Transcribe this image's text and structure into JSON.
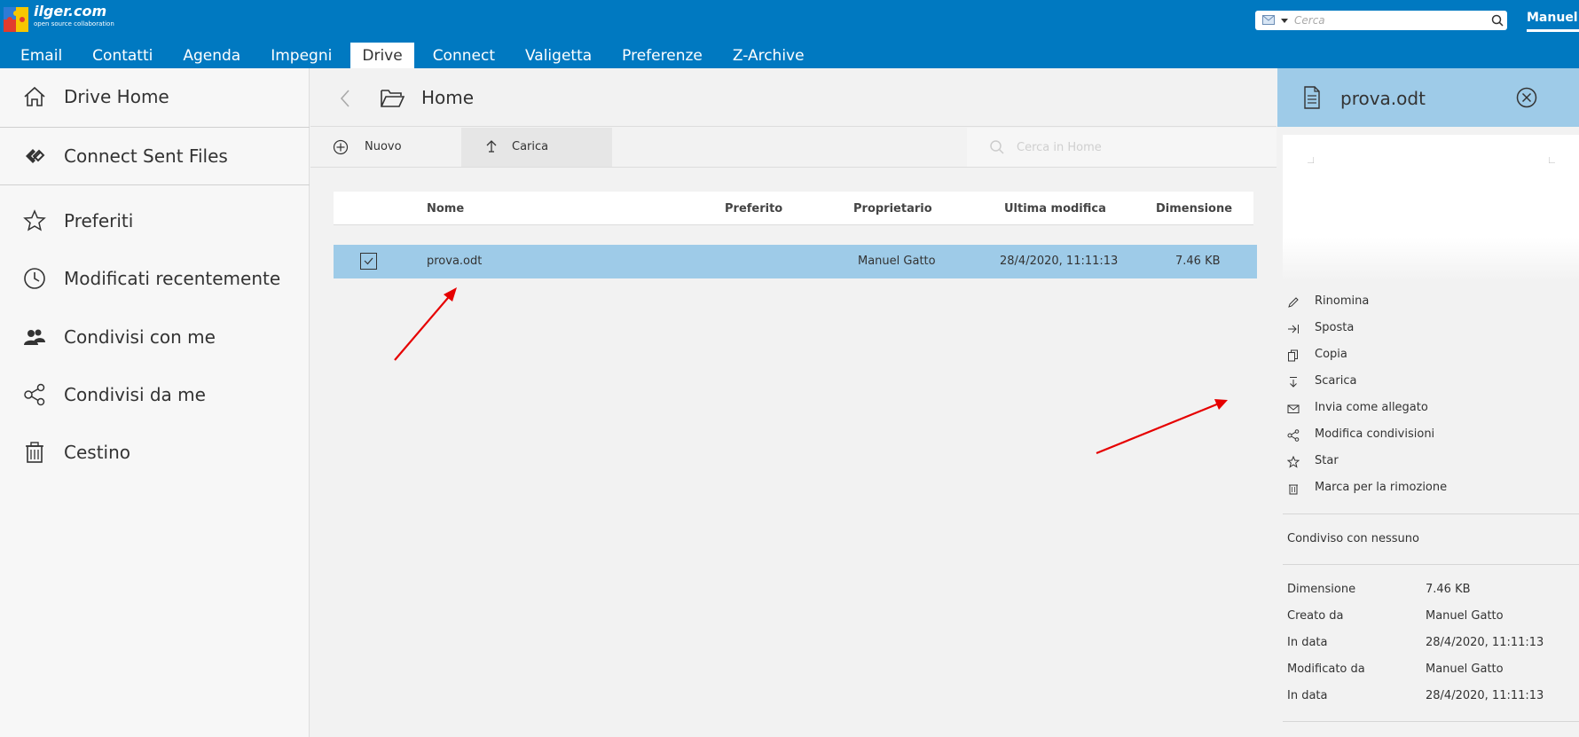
{
  "app": {
    "logo_text": "ilger.com",
    "logo_sub": "open source collaboration",
    "search_placeholder": "Cerca",
    "user": "Manuel"
  },
  "tabs": [
    {
      "label": "Email"
    },
    {
      "label": "Contatti"
    },
    {
      "label": "Agenda"
    },
    {
      "label": "Impegni"
    },
    {
      "label": "Drive",
      "active": true
    },
    {
      "label": "Connect"
    },
    {
      "label": "Valigetta"
    },
    {
      "label": "Preferenze"
    },
    {
      "label": "Z-Archive"
    }
  ],
  "sidebar": {
    "items": [
      {
        "label": "Drive Home",
        "icon": "home-icon"
      },
      {
        "label": "Connect Sent Files",
        "icon": "connect-icon"
      },
      {
        "label": "Preferiti",
        "icon": "star-icon"
      },
      {
        "label": "Modificati recentemente",
        "icon": "clock-icon"
      },
      {
        "label": "Condivisi con me",
        "icon": "people-icon"
      },
      {
        "label": "Condivisi da me",
        "icon": "share-icon"
      },
      {
        "label": "Cestino",
        "icon": "trash-icon"
      }
    ]
  },
  "main": {
    "breadcrumb": "Home",
    "toolbar": {
      "new_label": "Nuovo",
      "upload_label": "Carica",
      "search_placeholder": "Cerca in Home"
    },
    "columns": [
      "Nome",
      "Preferito",
      "Proprietario",
      "Ultima modifica",
      "Dimensione"
    ],
    "rows": [
      {
        "name": "prova.odt",
        "favorite": "",
        "owner": "Manuel Gatto",
        "modified": "28/4/2020, 11:11:13",
        "size": "7.46 KB",
        "selected": true
      }
    ]
  },
  "details": {
    "title": "prova.odt",
    "actions": [
      {
        "label": "Rinomina",
        "icon": "pencil-icon"
      },
      {
        "label": "Sposta",
        "icon": "move-icon"
      },
      {
        "label": "Copia",
        "icon": "copy-icon"
      },
      {
        "label": "Scarica",
        "icon": "download-icon"
      },
      {
        "label": "Invia come allegato",
        "icon": "envelope-icon"
      },
      {
        "label": "Modifica condivisioni",
        "icon": "share-icon"
      },
      {
        "label": "Star",
        "icon": "star-icon"
      },
      {
        "label": "Marca per la rimozione",
        "icon": "trash-icon"
      }
    ],
    "shared_with": "Condiviso con nessuno",
    "properties": [
      {
        "key": "Dimensione",
        "value": "7.46 KB"
      },
      {
        "key": "Creato da",
        "value": "Manuel Gatto"
      },
      {
        "key": "In data",
        "value": "28/4/2020, 11:11:13"
      },
      {
        "key": "Modificato da",
        "value": "Manuel Gatto"
      },
      {
        "key": "In data",
        "value": "28/4/2020, 11:11:13"
      }
    ]
  },
  "colors": {
    "topbar": "#0079c1",
    "selection": "#9ecbe8",
    "annotation_arrow": "#e60000"
  }
}
